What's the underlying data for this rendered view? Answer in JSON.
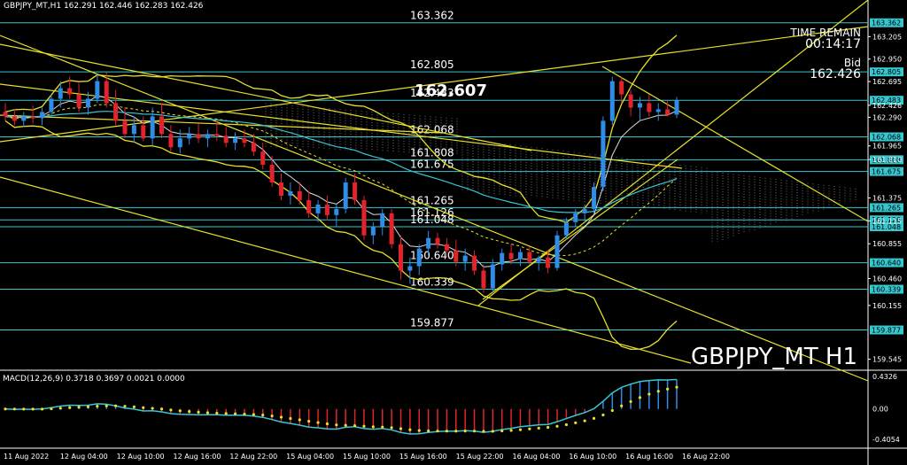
{
  "header": {
    "symbol_info": "GBPJPY_MT,H1",
    "ohlc": "162.291 162.446 162.283 162.426"
  },
  "overlay": {
    "time_remain_label": "TIME REMAIN",
    "time_remain_value": "00:14:17",
    "bid_label": "Bid",
    "bid_value": "162.426",
    "symbol_big": "GBPJPY_MT H1",
    "current_price_label": "162.607"
  },
  "macd": {
    "label": "MACD(12,26,9) 0.3718 0.3697 0.0021 0.0000"
  },
  "colors": {
    "background": "#000000",
    "bull_candle": "#2f8de8",
    "bear_candle": "#e3232b",
    "hline": "#36c7cf",
    "yellow": "#e8e028",
    "bands": "#e8e028",
    "ichimoku_cloud": "#c8c8c8",
    "ma_white": "#dcdcdc",
    "ma_cyan": "#38c5d6",
    "tag_bg": "#36c7cf"
  },
  "chart_data": {
    "type": "candlestick",
    "timeframe": "H1",
    "ylim": [
      159.45,
      163.5
    ],
    "price_axis_ticks": [
      "163.205",
      "162.950",
      "162.695",
      "162.426",
      "162.290",
      "161.965",
      "161.810",
      "161.375",
      "161.115",
      "160.855",
      "160.460",
      "160.155",
      "159.545"
    ],
    "horizontal_levels": [
      {
        "value": 163.362,
        "label": "163.362",
        "tag": "163.362"
      },
      {
        "value": 162.805,
        "label": "162.805",
        "tag": "162.805"
      },
      {
        "value": 162.483,
        "label": "162.483",
        "tag": "162.483"
      },
      {
        "value": 162.068,
        "label": "162.068",
        "tag": "162.068"
      },
      {
        "value": 161.808,
        "label": "161.808",
        "tag": "161.808"
      },
      {
        "value": 161.675,
        "label": "161.675",
        "tag": "161.675"
      },
      {
        "value": 161.265,
        "label": "161.265",
        "tag": "161.265"
      },
      {
        "value": 161.126,
        "label": "161.126",
        "tag": "161.126"
      },
      {
        "value": 161.048,
        "label": "161.048",
        "tag": "161.048"
      },
      {
        "value": 160.64,
        "label": "160.640",
        "tag": "160.640"
      },
      {
        "value": 160.339,
        "label": "160.339",
        "tag": "160.339"
      },
      {
        "value": 159.877,
        "label": "159.877",
        "tag": "159.877"
      }
    ],
    "x_labels": [
      "11 Aug 2022",
      "12 Aug 04:00",
      "12 Aug 10:00",
      "12 Aug 16:00",
      "12 Aug 22:00",
      "15 Aug 04:00",
      "15 Aug 10:00",
      "15 Aug 16:00",
      "15 Aug 22:00",
      "16 Aug 04:00",
      "16 Aug 10:00",
      "16 Aug 16:00",
      "16 Aug 22:00"
    ],
    "candles": [
      [
        162.35,
        162.45,
        162.25,
        162.3
      ],
      [
        162.3,
        162.38,
        162.2,
        162.25
      ],
      [
        162.25,
        162.35,
        162.18,
        162.3
      ],
      [
        162.3,
        162.42,
        162.22,
        162.28
      ],
      [
        162.28,
        162.4,
        162.2,
        162.35
      ],
      [
        162.35,
        162.55,
        162.3,
        162.5
      ],
      [
        162.5,
        162.7,
        162.4,
        162.62
      ],
      [
        162.62,
        162.75,
        162.5,
        162.55
      ],
      [
        162.55,
        162.68,
        162.35,
        162.4
      ],
      [
        162.4,
        162.58,
        162.32,
        162.5
      ],
      [
        162.5,
        162.78,
        162.45,
        162.7
      ],
      [
        162.7,
        162.8,
        162.4,
        162.45
      ],
      [
        162.45,
        162.6,
        162.2,
        162.25
      ],
      [
        162.25,
        162.4,
        162.05,
        162.1
      ],
      [
        162.1,
        162.3,
        162.0,
        162.2
      ],
      [
        162.2,
        162.3,
        162.02,
        162.05
      ],
      [
        162.05,
        162.4,
        161.95,
        162.3
      ],
      [
        162.3,
        162.45,
        162.05,
        162.1
      ],
      [
        162.1,
        162.2,
        161.9,
        161.95
      ],
      [
        161.95,
        162.15,
        161.88,
        162.05
      ],
      [
        162.05,
        162.18,
        161.98,
        162.1
      ],
      [
        162.1,
        162.22,
        162.0,
        162.05
      ],
      [
        162.05,
        162.15,
        161.95,
        162.1
      ],
      [
        162.1,
        162.25,
        162.02,
        162.08
      ],
      [
        162.08,
        162.18,
        161.95,
        162.0
      ],
      [
        162.0,
        162.12,
        161.92,
        162.05
      ],
      [
        162.05,
        162.15,
        161.95,
        162.0
      ],
      [
        162.0,
        162.1,
        161.85,
        161.9
      ],
      [
        161.9,
        162.0,
        161.7,
        161.75
      ],
      [
        161.75,
        161.85,
        161.5,
        161.55
      ],
      [
        161.55,
        161.65,
        161.35,
        161.4
      ],
      [
        161.4,
        161.55,
        161.3,
        161.45
      ],
      [
        161.45,
        161.55,
        161.3,
        161.35
      ],
      [
        161.35,
        161.45,
        161.15,
        161.2
      ],
      [
        161.2,
        161.35,
        161.1,
        161.3
      ],
      [
        161.3,
        161.4,
        161.12,
        161.18
      ],
      [
        161.18,
        161.3,
        161.05,
        161.25
      ],
      [
        161.25,
        161.6,
        161.2,
        161.55
      ],
      [
        161.55,
        161.65,
        161.3,
        161.35
      ],
      [
        161.35,
        161.4,
        160.9,
        160.95
      ],
      [
        160.95,
        161.1,
        160.85,
        161.05
      ],
      [
        161.05,
        161.25,
        160.95,
        161.2
      ],
      [
        161.2,
        161.25,
        160.8,
        160.85
      ],
      [
        160.85,
        160.95,
        160.45,
        160.55
      ],
      [
        160.55,
        160.7,
        160.4,
        160.6
      ],
      [
        160.6,
        160.85,
        160.5,
        160.8
      ],
      [
        160.8,
        161.0,
        160.72,
        160.92
      ],
      [
        160.92,
        160.98,
        160.8,
        160.85
      ],
      [
        160.85,
        160.92,
        160.7,
        160.78
      ],
      [
        160.78,
        160.9,
        160.6,
        160.65
      ],
      [
        160.65,
        160.8,
        160.55,
        160.72
      ],
      [
        160.72,
        160.78,
        160.5,
        160.55
      ],
      [
        160.55,
        160.62,
        160.3,
        160.35
      ],
      [
        160.35,
        160.68,
        160.3,
        160.62
      ],
      [
        160.62,
        160.8,
        160.55,
        160.75
      ],
      [
        160.75,
        160.85,
        160.62,
        160.68
      ],
      [
        160.68,
        160.8,
        160.6,
        160.76
      ],
      [
        160.76,
        160.82,
        160.62,
        160.65
      ],
      [
        160.65,
        160.72,
        160.55,
        160.7
      ],
      [
        160.7,
        160.78,
        160.52,
        160.58
      ],
      [
        160.58,
        161.0,
        160.55,
        160.95
      ],
      [
        160.95,
        161.15,
        160.9,
        161.1
      ],
      [
        161.1,
        161.25,
        161.05,
        161.2
      ],
      [
        161.2,
        161.3,
        161.1,
        161.25
      ],
      [
        161.25,
        161.55,
        161.2,
        161.5
      ],
      [
        161.5,
        162.3,
        161.45,
        162.25
      ],
      [
        162.25,
        162.75,
        162.2,
        162.7
      ],
      [
        162.7,
        162.75,
        162.45,
        162.55
      ],
      [
        162.55,
        162.6,
        162.3,
        162.4
      ],
      [
        162.4,
        162.52,
        162.25,
        162.45
      ],
      [
        162.45,
        162.55,
        162.3,
        162.35
      ],
      [
        162.35,
        162.45,
        162.25,
        162.38
      ],
      [
        162.38,
        162.48,
        162.3,
        162.32
      ],
      [
        162.32,
        162.52,
        162.28,
        162.48
      ]
    ],
    "macd_ylim": [
      -0.4504,
      0.4326
    ],
    "macd_ticks": [
      "0.4326",
      "0.00",
      "-0.4054"
    ]
  }
}
